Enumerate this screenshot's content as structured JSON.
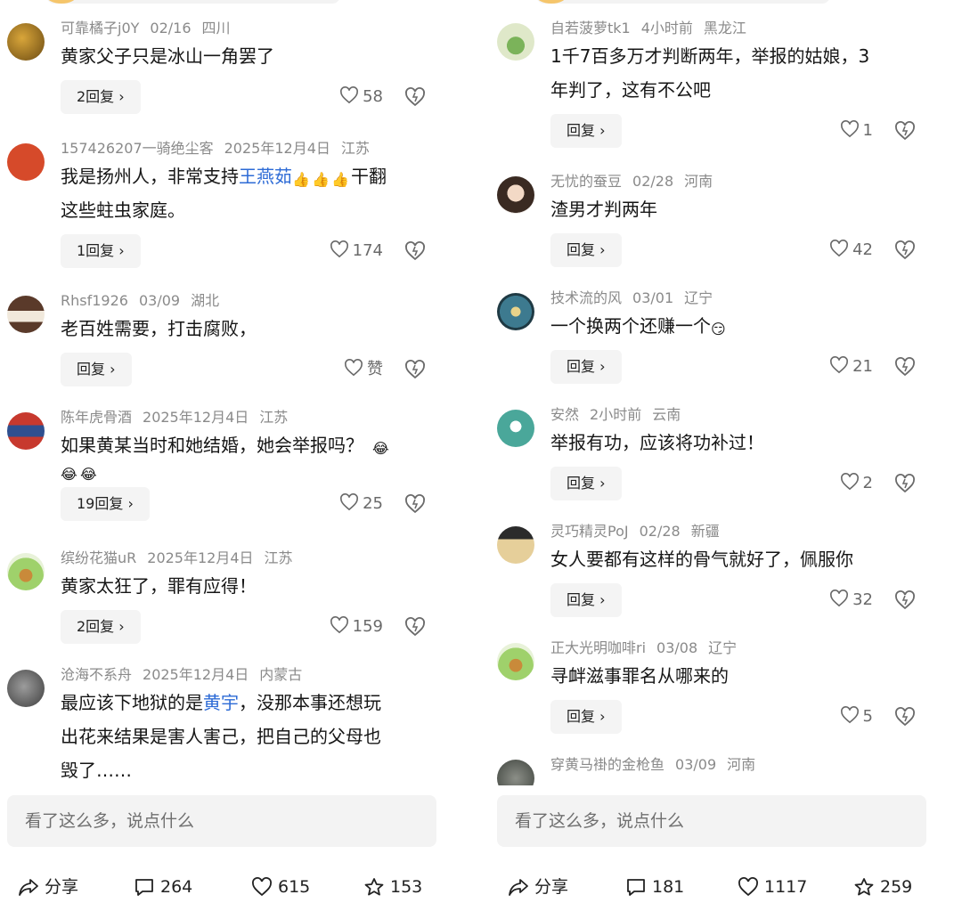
{
  "left": {
    "comments": [
      {
        "user": "可靠橘子j0Y",
        "date": "02/16",
        "region": "四川",
        "lines": [
          "黄家父子只是冰山一角罢了"
        ],
        "reply": "2回复 ›",
        "likes": "58"
      },
      {
        "user": "157426207一骑绝尘客",
        "date": "2025年12月4日",
        "region": "江苏",
        "line1_a": "我是扬州人，非常支持",
        "line1_hl": "王燕茹",
        "line1_b": "干翻",
        "line2": "这些蛀虫家庭。",
        "reply": "1回复 ›",
        "likes": "174"
      },
      {
        "user": "Rhsf1926",
        "date": "03/09",
        "region": "湖北",
        "lines": [
          "老百姓需要，打击腐败，"
        ],
        "reply": "回复 ›",
        "likes": "赞"
      },
      {
        "user": "陈年虎骨酒",
        "date": "2025年12月4日",
        "region": "江苏",
        "lines": [
          "如果黄某当时和她结婚，她会举报吗？"
        ],
        "reply": "19回复 ›",
        "likes": "25"
      },
      {
        "user": "缤纷花猫uR",
        "date": "2025年12月4日",
        "region": "江苏",
        "lines": [
          "黄家太狂了，罪有应得！"
        ],
        "reply": "2回复 ›",
        "likes": "159"
      },
      {
        "user": "沧海不系舟",
        "date": "2025年12月4日",
        "region": "内蒙古",
        "line1_a": "最应该下地狱的是",
        "line1_hl": "黄宇",
        "line1_b": "，没那本事还想玩",
        "line2": "出花来结果是害人害己，把自己的父母也",
        "line3": "毁了……"
      }
    ],
    "input_placeholder": "看了这么多，说点什么",
    "bottom": {
      "share": "分享",
      "comments": "264",
      "likes": "615",
      "favorites": "153"
    }
  },
  "right": {
    "comments": [
      {
        "user": "自若菠萝tk1",
        "date": "4小时前",
        "region": "黑龙江",
        "lines": [
          "1千7百多万才判断两年，举报的姑娘，3",
          "年判了，这有不公吧"
        ],
        "reply": "回复 ›",
        "likes": "1"
      },
      {
        "user": "无忧的蚕豆",
        "date": "02/28",
        "region": "河南",
        "lines": [
          "渣男才判两年"
        ],
        "reply": "回复 ›",
        "likes": "42"
      },
      {
        "user": "技术流的风",
        "date": "03/01",
        "region": "辽宁",
        "lines": [
          "一个换两个还赚一个"
        ],
        "reply": "回复 ›",
        "likes": "21"
      },
      {
        "user": "安然",
        "date": "2小时前",
        "region": "云南",
        "lines": [
          "举报有功，应该将功补过！"
        ],
        "reply": "回复 ›",
        "likes": "2"
      },
      {
        "user": "灵巧精灵PoJ",
        "date": "02/28",
        "region": "新疆",
        "lines": [
          "女人要都有这样的骨气就好了，佩服你"
        ],
        "reply": "回复 ›",
        "likes": "32"
      },
      {
        "user": "正大光明咖啡ri",
        "date": "03/08",
        "region": "辽宁",
        "lines": [
          "寻衅滋事罪名从哪来的"
        ],
        "reply": "回复 ›",
        "likes": "5"
      },
      {
        "user": "穿黄马褂的金枪鱼",
        "date": "03/09",
        "region": "河南"
      }
    ],
    "input_placeholder": "看了这么多，说点什么",
    "bottom": {
      "share": "分享",
      "comments": "181",
      "likes": "1117",
      "favorites": "259"
    }
  },
  "icons": {
    "like": "heart-icon",
    "dislike": "dislike-icon",
    "share": "share-icon",
    "comment": "comment-icon",
    "favorite": "star-icon"
  },
  "colors": {
    "highlight": "#2d6bd6",
    "meta": "#8a8a8a",
    "reply_bg": "#f4f4f4",
    "input_bg": "#f3f3f3"
  }
}
